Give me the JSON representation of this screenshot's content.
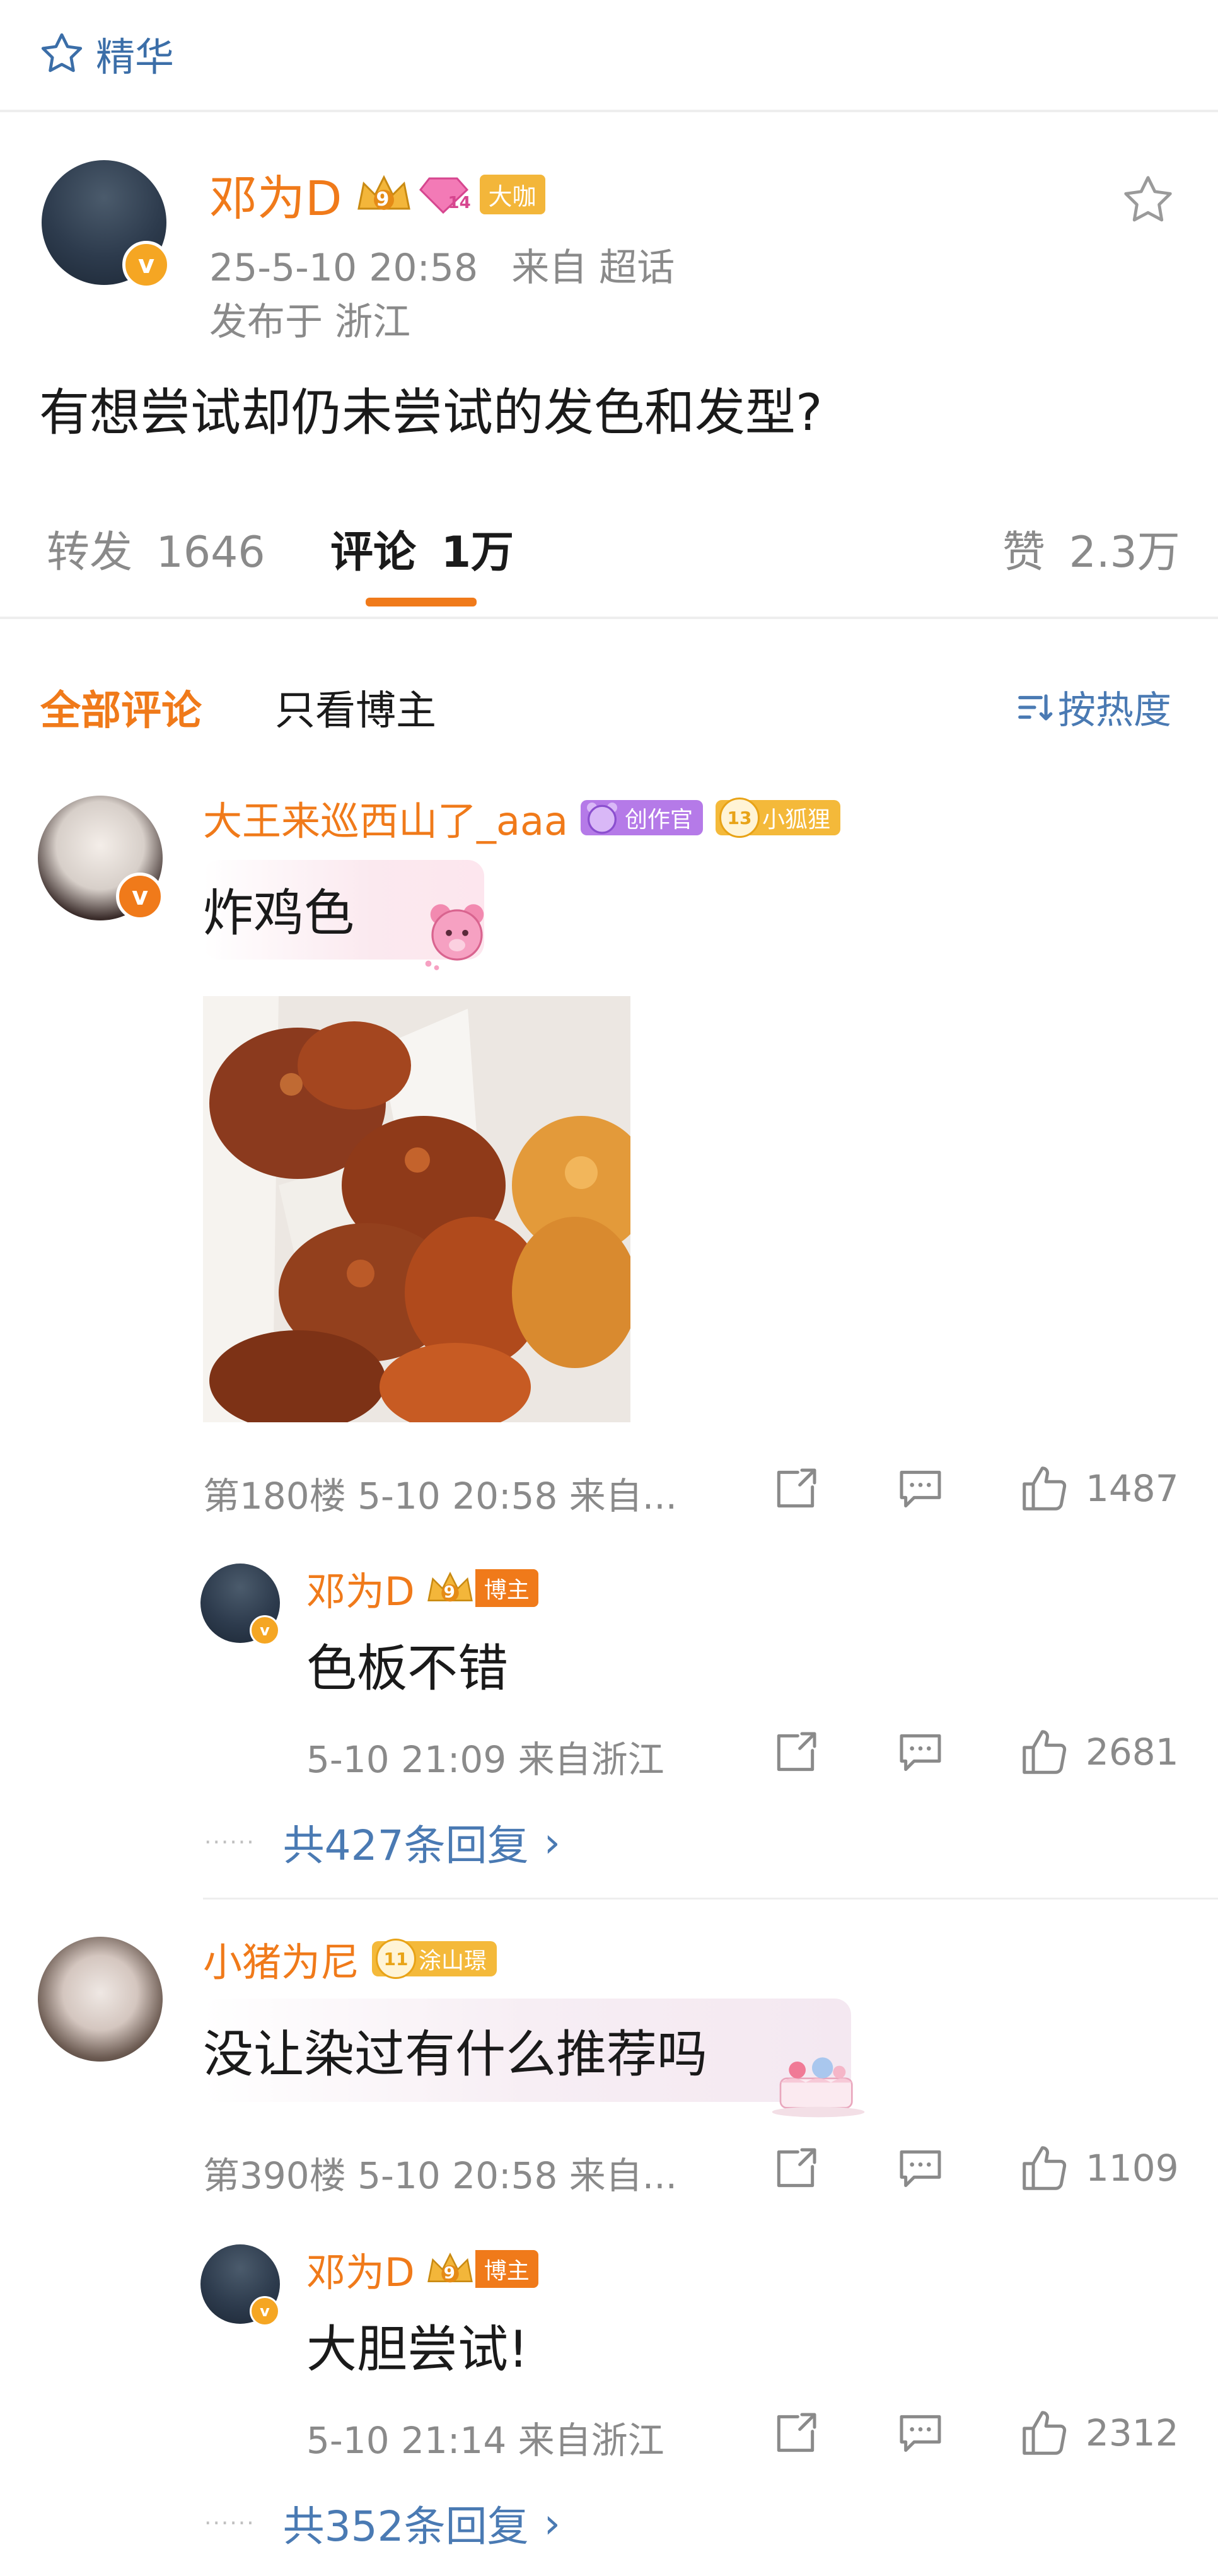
{
  "header": {
    "featured_label": "精华",
    "star_icon": "star-icon"
  },
  "post": {
    "author": "邓为D",
    "author_badge": "大咖",
    "level_badge_1": "9",
    "level_badge_2": "14",
    "timestamp": "25-5-10 20:58",
    "source": "来自 超话",
    "location": "发布于 浙江",
    "content": "有想尝试却仍未尝试的发色和发型?",
    "verified_glyph": "v"
  },
  "tabs": {
    "repost_label": "转发",
    "repost_count": "1646",
    "comment_label": "评论",
    "comment_count": "1万",
    "like_label": "赞",
    "like_count": "2.3万"
  },
  "filter": {
    "all_comments": "全部评论",
    "only_author": "只看博主",
    "sort_label": "按热度"
  },
  "comments": [
    {
      "user": "大王来巡西山了_aaa",
      "badge1": "创作官",
      "badge2_level": "13",
      "badge2": "小狐狸",
      "text": "炸鸡色",
      "floor_meta": "第180楼 5-10 20:58 来自...",
      "likes": "1487",
      "reply": {
        "user": "邓为D",
        "level": "9",
        "role": "博主",
        "text": "色板不错",
        "meta": "5-10 21:09 来自浙江",
        "likes": "2681"
      },
      "more_replies": "共427条回复"
    },
    {
      "user": "小猪为尼",
      "badge1_level": "11",
      "badge1": "涂山璟",
      "text": "没让染过有什么推荐吗",
      "floor_meta": "第390楼 5-10 20:58 来自...",
      "likes": "1109",
      "reply": {
        "user": "邓为D",
        "level": "9",
        "role": "博主",
        "text": "大胆尝试!",
        "meta": "5-10 21:14 来自浙江",
        "likes": "2312"
      },
      "more_replies": "共352条回复"
    }
  ],
  "misc": {
    "chevron": "›",
    "dots": "······"
  }
}
